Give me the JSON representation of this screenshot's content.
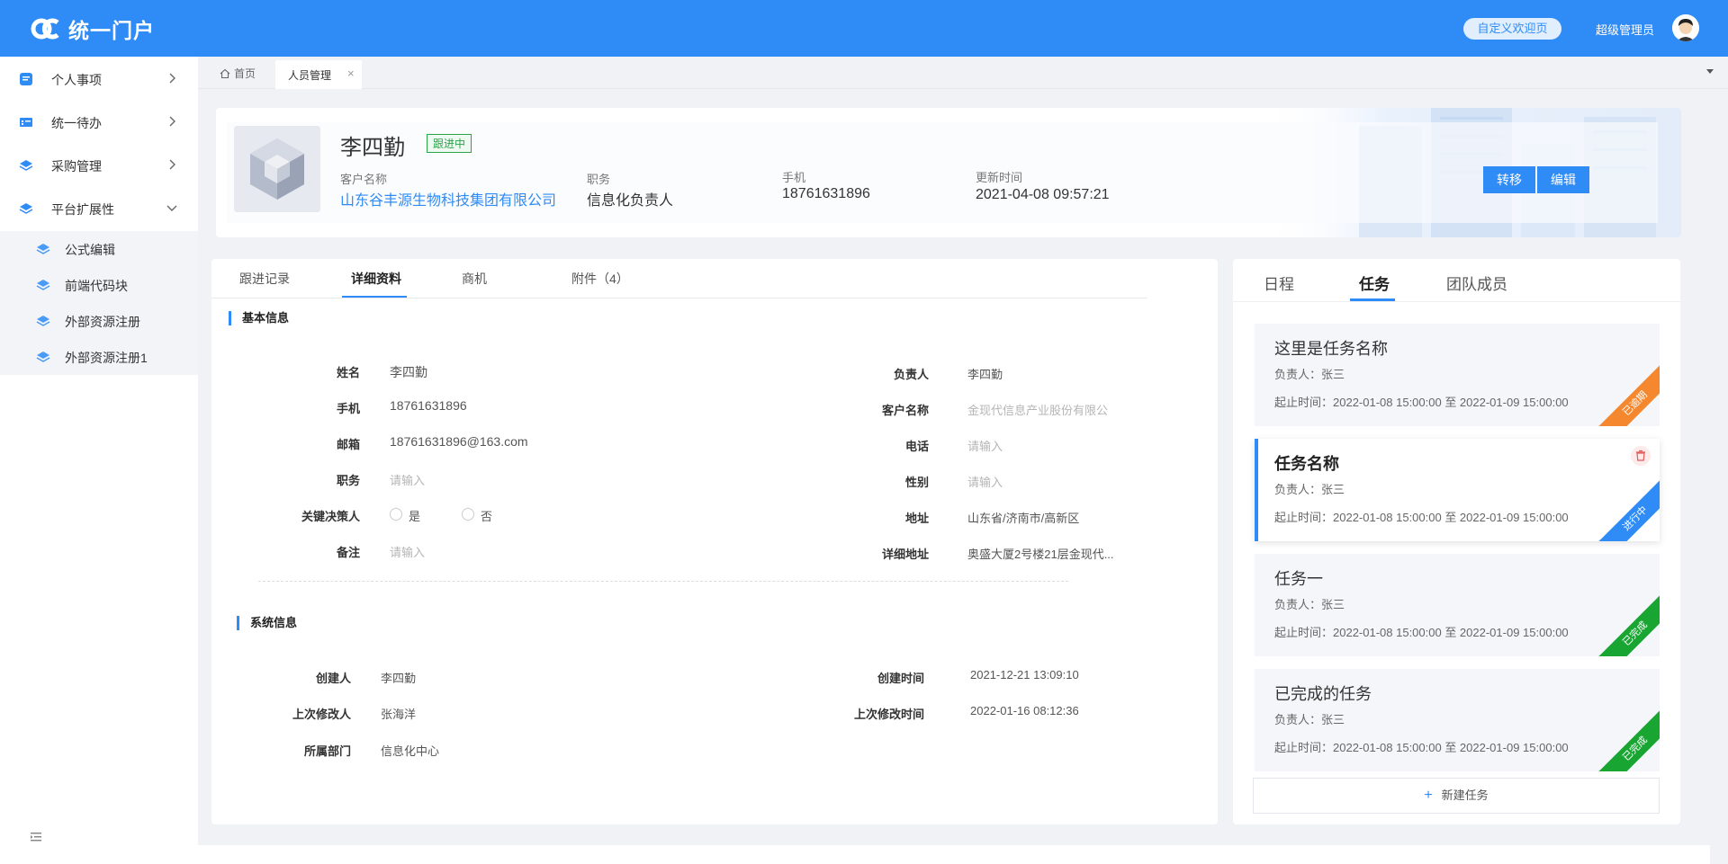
{
  "app": {
    "title": "统一门户",
    "custom_welcome": "自定义欢迎页",
    "user": "超级管理员"
  },
  "sidebar": {
    "items": [
      {
        "label": "个人事项",
        "icon": "doc-icon"
      },
      {
        "label": "统一待办",
        "icon": "todo-icon"
      },
      {
        "label": "采购管理",
        "icon": "layers-icon"
      },
      {
        "label": "平台扩展性",
        "icon": "layers-icon",
        "expanded": true
      }
    ],
    "sub_items": [
      {
        "label": "公式编辑"
      },
      {
        "label": "前端代码块"
      },
      {
        "label": "外部资源注册"
      },
      {
        "label": "外部资源注册1"
      }
    ]
  },
  "tabs": {
    "home": "首页",
    "active": "人员管理",
    "close": "×"
  },
  "profile": {
    "name": "李四勤",
    "status": "跟进中",
    "fields": [
      {
        "label": "客户名称",
        "value": "山东谷丰源生物科技集团有限公司"
      },
      {
        "label": "职务",
        "value": "信息化负责人"
      },
      {
        "label": "手机",
        "value": "18761631896"
      },
      {
        "label": "更新时间",
        "value": "2021-04-08 09:57:21"
      }
    ],
    "buttons": {
      "transfer": "转移",
      "edit": "编辑"
    }
  },
  "detail": {
    "tabs": [
      "跟进记录",
      "详细资料",
      "商机",
      "附件（4）"
    ],
    "active_tab": "详细资料",
    "basic_title": "基本信息",
    "basic_left": [
      {
        "label": "姓名",
        "value": "李四勤"
      },
      {
        "label": "手机",
        "value": "18761631896"
      },
      {
        "label": "邮箱",
        "value": "18761631896@163.com"
      },
      {
        "label": "职务",
        "value": "请输入"
      },
      {
        "label": "关键决策人",
        "value": ""
      },
      {
        "label": "备注",
        "value": "请输入"
      }
    ],
    "radio_yes": "是",
    "radio_no": "否",
    "basic_right": [
      {
        "label": "负责人",
        "value": "李四勤"
      },
      {
        "label": "客户名称",
        "value": "金现代信息产业股份有限公"
      },
      {
        "label": "电话",
        "value": "请输入"
      },
      {
        "label": "性别",
        "value": "请输入"
      },
      {
        "label": "地址",
        "value": "山东省/济南市/高新区"
      },
      {
        "label": "详细地址",
        "value": "奥盛大厦2号楼21层金现代..."
      }
    ],
    "system_title": "系统信息",
    "system_left": [
      {
        "label": "创建人",
        "value": "李四勤"
      },
      {
        "label": "上次修改人",
        "value": "张海洋"
      },
      {
        "label": "所属部门",
        "value": "信息化中心"
      }
    ],
    "system_right": [
      {
        "label": "创建时间",
        "value": "2021-12-21 13:09:10"
      },
      {
        "label": "上次修改时间",
        "value": "2022-01-16 08:12:36"
      }
    ]
  },
  "right": {
    "tabs": [
      "日程",
      "任务",
      "团队成员"
    ],
    "active_tab": "任务",
    "tasks": [
      {
        "title": "这里是任务名称",
        "owner": "负责人：张三",
        "deadline": "起止时间：2022-01-08 15:00:00 至 2022-01-09 15:00:00",
        "status": "已逾期",
        "status_color": "#f5872e"
      },
      {
        "title": "任务名称",
        "owner": "负责人：张三",
        "deadline": "起止时间：2022-01-08 15:00:00 至 2022-01-09 15:00:00",
        "status": "进行中",
        "status_color": "#2f8bf6"
      },
      {
        "title": "任务一",
        "owner": "负责人：张三",
        "deadline": "起止时间：2022-01-08 15:00:00 至 2022-01-09 15:00:00",
        "status": "已完成",
        "status_color": "#18a532"
      },
      {
        "title": "已完成的任务",
        "owner": "负责人：张三",
        "deadline": "起止时间：2022-01-08 15:00:00 至 2022-01-09 15:00:00",
        "status": "已完成",
        "status_color": "#18a532"
      }
    ],
    "new_task": "新建任务",
    "new_task_icon": "+"
  }
}
